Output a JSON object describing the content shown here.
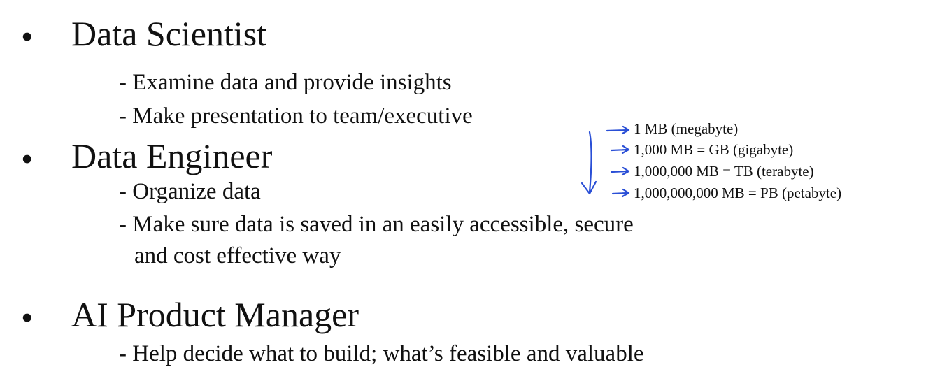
{
  "sections": [
    {
      "bullet": "•",
      "title": "Data Scientist",
      "items": [
        "- Examine data and provide insights",
        "- Make presentation to team/executive"
      ]
    },
    {
      "bullet": "•",
      "title": "Data Engineer",
      "items": [
        "- Organize data",
        "- Make sure data is saved in an easily accessible, secure",
        "and cost effective way"
      ]
    },
    {
      "bullet": "•",
      "title": "AI Product Manager",
      "items": [
        "- Help decide what to build; what’s feasible and valuable"
      ]
    }
  ],
  "annotations": {
    "color": "#2a4fd6",
    "lines": [
      "1 MB (megabyte)",
      "1,000 MB = GB (gigabyte)",
      "1,000,000 MB = TB (terabyte)",
      "1,000,000,000 MB = PB (petabyte)"
    ]
  }
}
